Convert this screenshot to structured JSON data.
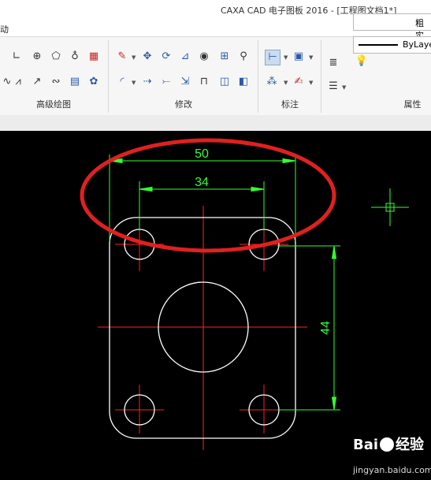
{
  "window": {
    "title": "CAXA CAD 电子图板 2016 - [工程图文档1*]"
  },
  "menu": {
    "visible_item": "动"
  },
  "ribbon": {
    "panels": [
      {
        "label": "高级绘图"
      },
      {
        "label": "修改"
      },
      {
        "label": "标注"
      },
      {
        "label": "属性"
      }
    ],
    "layer_combo": {
      "value": "粗实"
    },
    "linetype_combo": {
      "value": "ByLaye"
    }
  },
  "drawing": {
    "dimensions": [
      {
        "value": "50",
        "orientation": "horizontal",
        "color": "#32ff32"
      },
      {
        "value": "34",
        "orientation": "horizontal",
        "color": "#32ff32"
      },
      {
        "value": "44",
        "orientation": "vertical",
        "color": "#32ff32"
      }
    ],
    "line_colors": {
      "outline": "#ffffff",
      "centerline": "#ff2020",
      "dimension": "#32ff32",
      "annotation_ellipse": "#e02020"
    }
  },
  "watermark": {
    "brand": "Bai du 经验",
    "url": "jingyan.baidu.com"
  }
}
